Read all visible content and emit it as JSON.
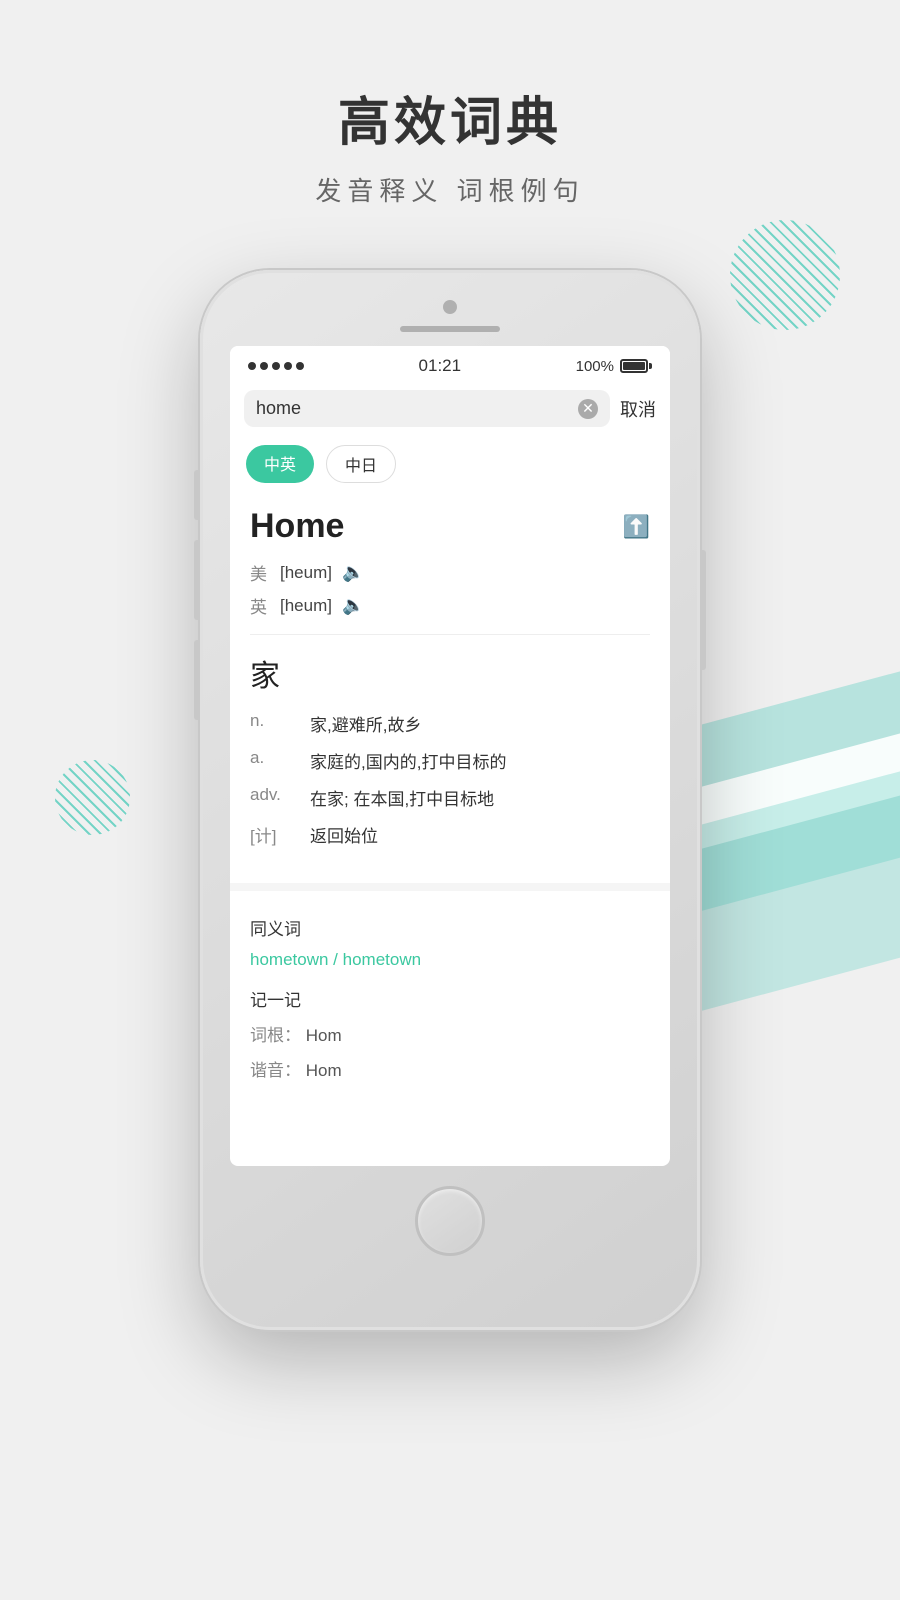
{
  "header": {
    "title": "高效词典",
    "subtitle": "发音释义   词根例句"
  },
  "status_bar": {
    "time": "01:21",
    "battery": "100%",
    "dots_count": 5
  },
  "search": {
    "query": "home",
    "cancel_label": "取消"
  },
  "language_tabs": [
    {
      "label": "中英",
      "active": true
    },
    {
      "label": "中日",
      "active": false
    }
  ],
  "word": {
    "english": "Home",
    "pronunciation_us_label": "美",
    "pronunciation_uk_label": "英",
    "pronunciation_text": "[heum]",
    "chinese": "家",
    "definitions": [
      {
        "type": "n.",
        "meaning": "家,避难所,故乡"
      },
      {
        "type": "a.",
        "meaning": "家庭的,国内的,打中目标的"
      },
      {
        "type": "adv.",
        "meaning": "在家; 在本国,打中目标地"
      },
      {
        "type": "[计]",
        "meaning": "返回始位"
      }
    ],
    "synonyms_label": "同义词",
    "synonyms": [
      {
        "text": "hometown",
        "separator": " / "
      },
      {
        "text": "hometown"
      }
    ],
    "memory_label": "记一记",
    "word_root_label": "词根：",
    "word_root": "Hom",
    "phonetic_label": "谐音：",
    "phonetic": "Hom"
  }
}
